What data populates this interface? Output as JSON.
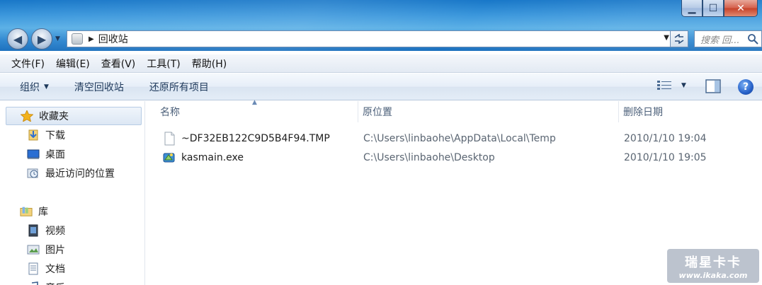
{
  "window": {
    "minimize_glyph": "▁",
    "maximize_glyph": "☐",
    "close_glyph": "✕"
  },
  "nav": {
    "back_glyph": "◀",
    "forward_glyph": "▶",
    "address_separator": "▶",
    "address_text": "回收站",
    "address_dropdown": "▼",
    "search_placeholder": "搜索 回..."
  },
  "menu": {
    "items": [
      {
        "label": "文件(F)"
      },
      {
        "label": "编辑(E)"
      },
      {
        "label": "查看(V)"
      },
      {
        "label": "工具(T)"
      },
      {
        "label": "帮助(H)"
      }
    ]
  },
  "toolbar": {
    "organize_label": "组织",
    "organize_caret": "▼",
    "empty_bin_label": "清空回收站",
    "restore_all_label": "还原所有项目",
    "view_caret": "▼",
    "help_glyph": "?"
  },
  "sidebar": {
    "items": [
      {
        "label": "收藏夹",
        "icon": "star-icon"
      },
      {
        "label": "下载",
        "icon": "downloads-icon"
      },
      {
        "label": "桌面",
        "icon": "desktop-icon"
      },
      {
        "label": "最近访问的位置",
        "icon": "recent-places-icon"
      },
      {
        "label": "库",
        "icon": "libraries-icon"
      },
      {
        "label": "视频",
        "icon": "videos-icon"
      },
      {
        "label": "图片",
        "icon": "pictures-icon"
      },
      {
        "label": "文档",
        "icon": "documents-icon"
      },
      {
        "label": "音乐",
        "icon": "music-icon"
      }
    ]
  },
  "columns": {
    "name": "名称",
    "original_location": "原位置",
    "date_deleted": "删除日期",
    "sort_glyph": "▲"
  },
  "files": [
    {
      "name": "~DF32EB122C9D5B4F94.TMP",
      "location": "C:\\Users\\linbaohe\\AppData\\Local\\Temp",
      "date": "2010/1/10 19:04",
      "icon": "blank-file-icon"
    },
    {
      "name": "kasmain.exe",
      "location": "C:\\Users\\linbaohe\\Desktop",
      "date": "2010/1/10 19:05",
      "icon": "exe-app-icon"
    }
  ],
  "watermark": {
    "title": "瑞星卡卡",
    "url": "www.ikaka.com"
  },
  "colors": {
    "title_bar": "#3b97dc",
    "command_bar": "#e6eef8",
    "selection": "#dce7f4",
    "close_button": "#c7432b"
  }
}
